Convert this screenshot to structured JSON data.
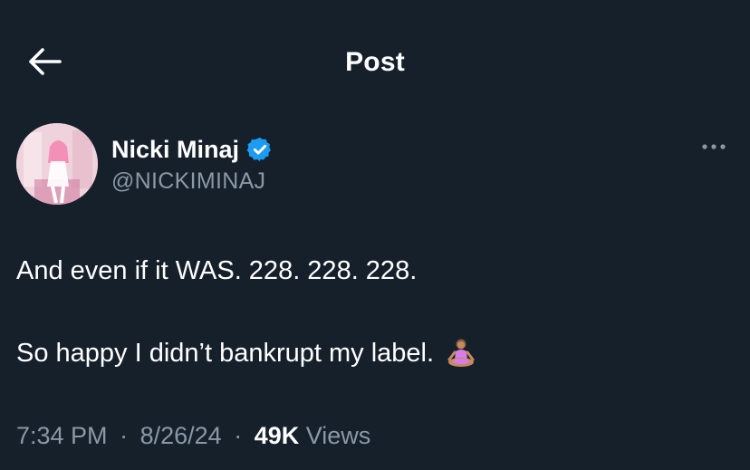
{
  "header": {
    "title": "Post",
    "back_icon": "arrow-left-icon"
  },
  "author": {
    "display_name": "Nicki Minaj",
    "handle": "@NICKIMINAJ",
    "verified": true,
    "verified_color": "#1d9bf0",
    "avatar_icon": "profile-photo",
    "more_icon": "more-horizontal-icon"
  },
  "tweet": {
    "line1": "And even if it WAS. 228. 228. 228.",
    "line2": "So happy I didn’t bankrupt my label.",
    "emoji": "meditating-woman-emoji"
  },
  "meta": {
    "time": "7:34 PM",
    "separator": "·",
    "date": "8/26/24",
    "views_count": "49K",
    "views_label": "Views"
  },
  "colors": {
    "background": "#15202b",
    "text": "#ffffff",
    "secondary_text": "#8b98a5"
  }
}
